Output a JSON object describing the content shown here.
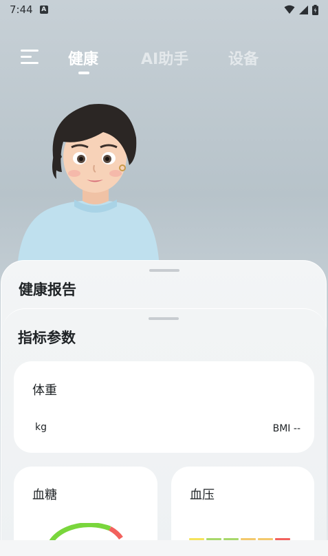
{
  "status_bar": {
    "time": "7:44",
    "notification_badge": "A"
  },
  "nav": {
    "tabs": [
      {
        "label": "健康",
        "active": true
      },
      {
        "label": "AI助手",
        "active": false
      },
      {
        "label": "设备",
        "active": false
      }
    ]
  },
  "report": {
    "title": "健康报告"
  },
  "metrics": {
    "title": "指标参数",
    "weight": {
      "label": "体重",
      "unit": "kg",
      "bmi": "BMI --"
    },
    "blood_sugar": {
      "label": "血糖"
    },
    "blood_pressure": {
      "label": "血压"
    }
  },
  "colors": {
    "gauge_green": "#79d63c",
    "gauge_red": "#f2615d",
    "bp_segments": [
      "#f5e35a",
      "#a8d86a",
      "#a8d86a",
      "#f3c86b",
      "#f3c86b",
      "#f2615d"
    ]
  }
}
